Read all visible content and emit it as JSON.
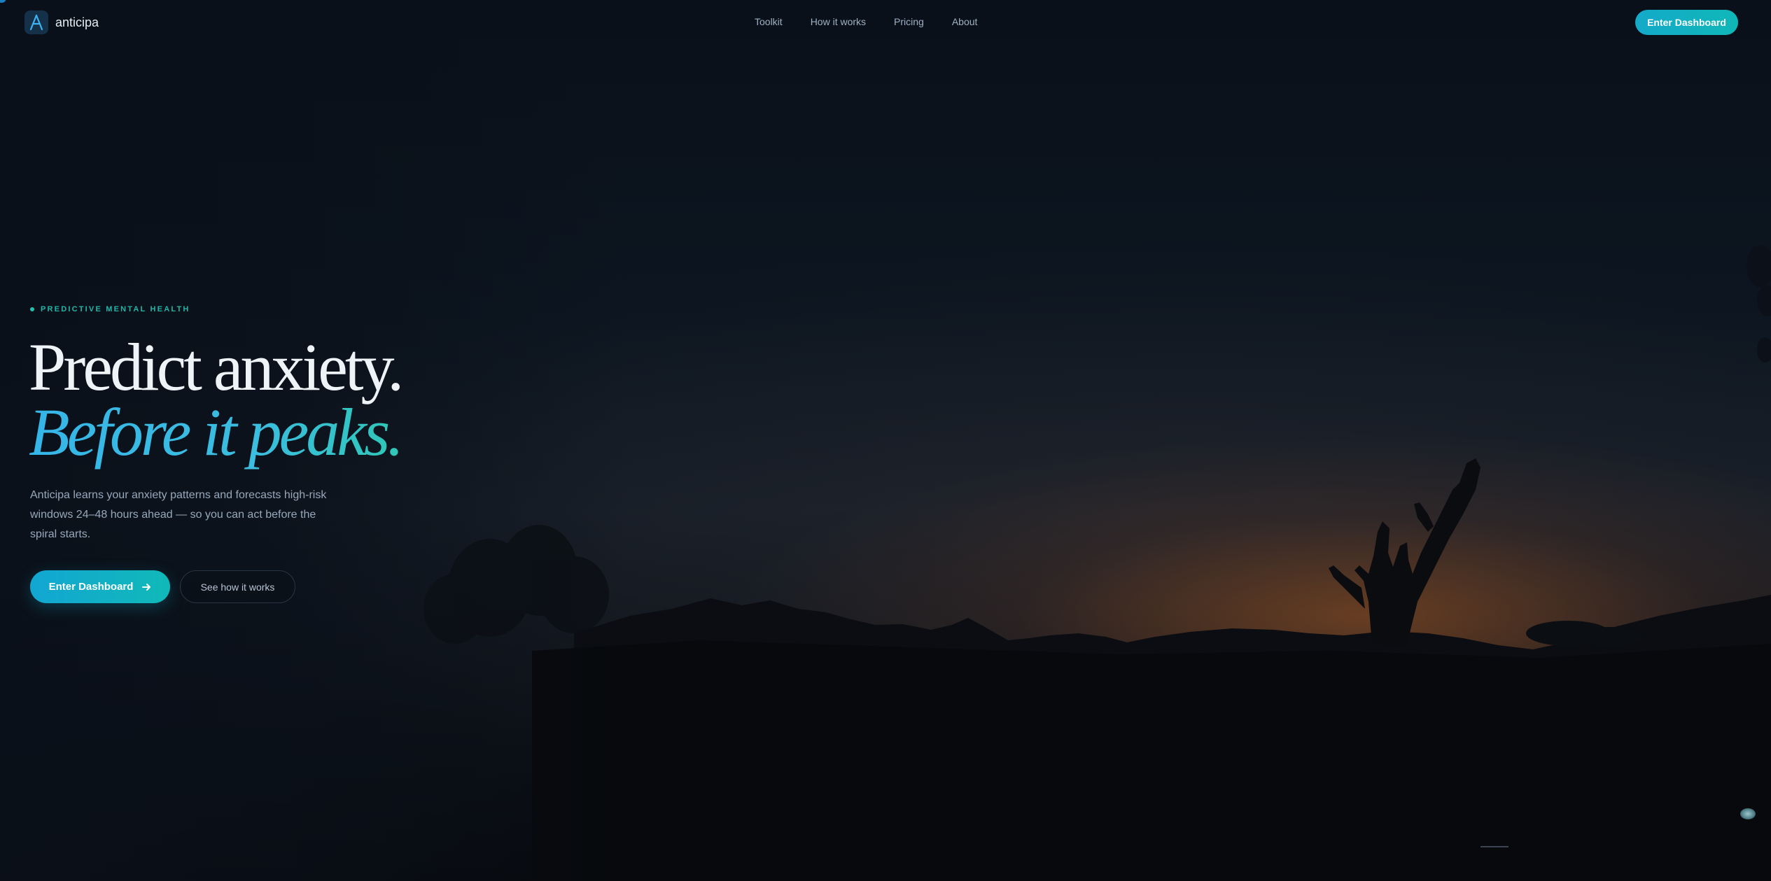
{
  "brand": {
    "name": "anticipa",
    "logo_letter": "A"
  },
  "nav": {
    "links": [
      {
        "label": "Toolkit"
      },
      {
        "label": "How it works"
      },
      {
        "label": "Pricing"
      },
      {
        "label": "About"
      }
    ],
    "cta_label": "Enter Dashboard"
  },
  "hero": {
    "eyebrow": "PREDICTIVE MENTAL HEALTH",
    "headline_line1": "Predict anxiety.",
    "headline_line2": "Before it peaks.",
    "subcopy": "Anticipa learns your anxiety patterns and forecasts high-risk windows 24–48 hours ahead — so you can act before the spiral starts.",
    "primary_cta": "Enter Dashboard",
    "secondary_cta": "See how it works"
  },
  "icons": {
    "logo": "letter-a-logo-icon",
    "primary_cta_icon": "arrow-right-icon"
  },
  "colors": {
    "accent": "#12a6d2",
    "accent_teal": "#10b9b8",
    "background": "#0a1019",
    "sunset": "#a85820"
  }
}
